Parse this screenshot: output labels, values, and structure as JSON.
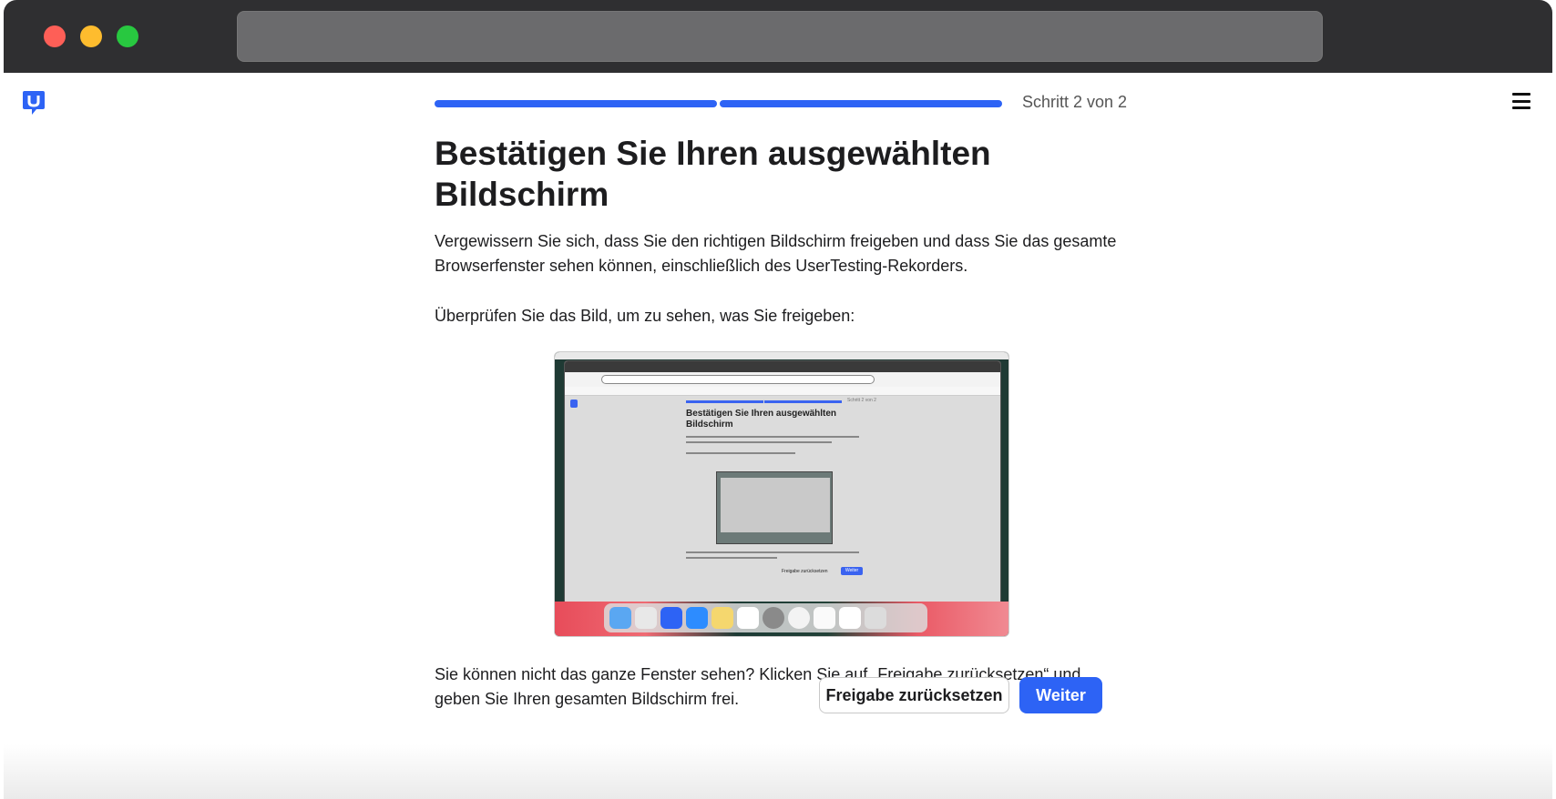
{
  "window": {
    "controls": [
      "close",
      "minimize",
      "maximize"
    ],
    "address_bar_value": ""
  },
  "header": {
    "logo_icon": "usertesting-logo-icon",
    "progress": {
      "current_step": 2,
      "total_steps": 2,
      "completed_fraction": 1.0
    },
    "step_label": "Schritt 2 von 2",
    "menu_icon": "hamburger-menu-icon"
  },
  "main": {
    "title": "Bestätigen Sie Ihren ausgewählten Bildschirm",
    "intro": "Vergewissern Sie sich, dass Sie den richtigen Bildschirm freigeben und dass Sie das gesamte Browserfenster sehen können, einschließlich des UserTesting-Rekorders.",
    "check_prompt": "Überprüfen Sie das Bild, um zu sehen, was Sie freigeben:",
    "preview": {
      "title": "Bestätigen Sie Ihren ausgewählten Bildschirm",
      "step_label": "Schritt 2 von 2",
      "reset_label": "Freigabe zurücksetzen",
      "next_label": "Weiter"
    },
    "help_text": "Sie können nicht das ganze Fenster sehen? Klicken Sie auf „Freigabe zurücksetzen“ und geben Sie Ihren gesamten Bildschirm frei."
  },
  "actions": {
    "reset_label": "Freigabe zurücksetzen",
    "next_label": "Weiter"
  },
  "colors": {
    "accent": "#2d63f5",
    "text": "#1d1d1f",
    "chrome": "#2f2f31"
  }
}
